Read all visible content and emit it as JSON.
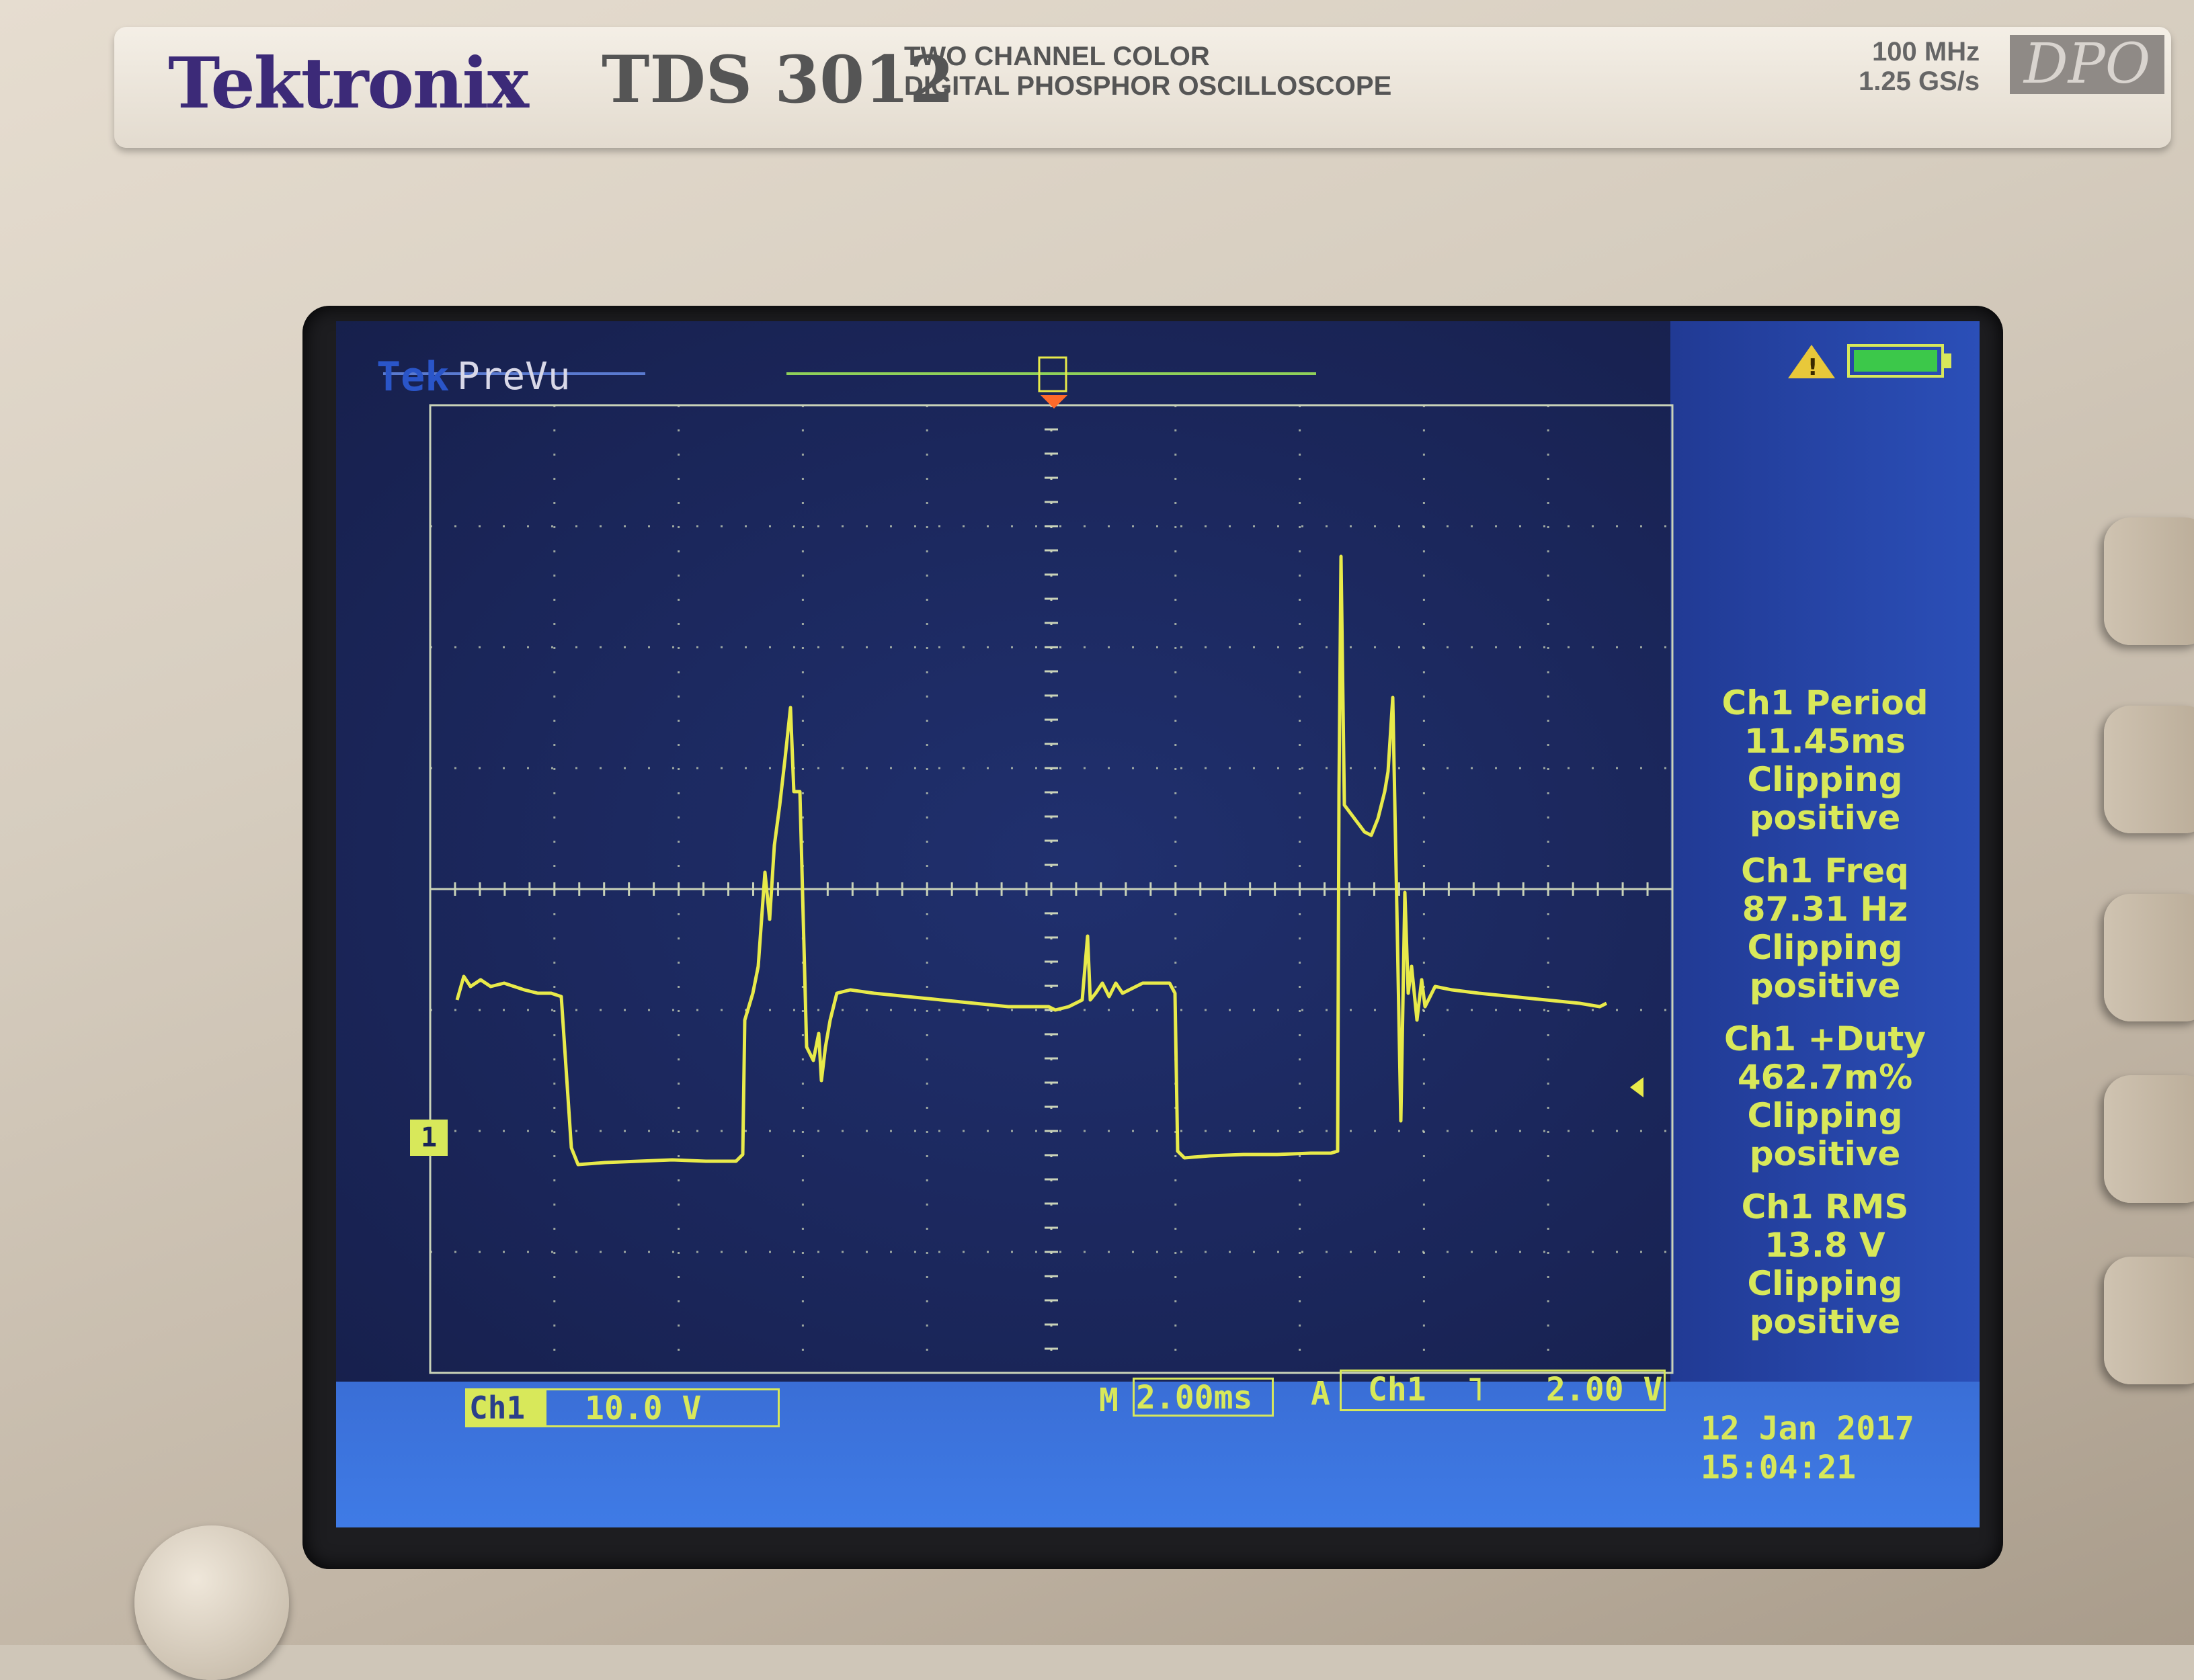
{
  "header": {
    "brand": "Tektronix",
    "model": "TDS 3012",
    "description_line1": "TWO CHANNEL COLOR",
    "description_line2": "DIGITAL PHOSPHOR OSCILLOSCOPE",
    "bandwidth": "100 MHz",
    "sample_rate": "1.25 GS/s",
    "badge": "DPO"
  },
  "screen": {
    "tek_label": "Tek",
    "mode": "PreVu",
    "channel_marker": "1",
    "measurements": [
      {
        "title": "Ch1 Period",
        "value": "11.45ms",
        "status1": "Clipping",
        "status2": "positive"
      },
      {
        "title": "Ch1 Freq",
        "value": "87.31 Hz",
        "status1": "Clipping",
        "status2": "positive"
      },
      {
        "title": "Ch1 +Duty",
        "value": "462.7m%",
        "status1": "Clipping",
        "status2": "positive"
      },
      {
        "title": "Ch1 RMS",
        "value": "13.8 V",
        "status1": "Clipping",
        "status2": "positive"
      }
    ],
    "status": {
      "channel": "Ch1",
      "volts_per_div": "10.0 V",
      "timebase_prefix": "M",
      "timebase": "2.00ms",
      "trigger_prefix": "A",
      "trigger_channel": "Ch1",
      "trigger_slope": "˥",
      "trigger_level": "2.00 V",
      "date": "12 Jan  2017",
      "time": "15:04:21"
    }
  },
  "colors": {
    "trace": "#e8ea4a",
    "grid": "#c9d2b8",
    "screen_bg": "#1a2558",
    "status_bg": "#3f7be6",
    "brand": "#3c2a78"
  },
  "icons": {
    "warning": "warning-icon",
    "battery": "battery-icon",
    "trigger_marker": "trigger-position-icon",
    "ground_marker": "channel-1-ground-icon",
    "printer": "printer-icon"
  }
}
